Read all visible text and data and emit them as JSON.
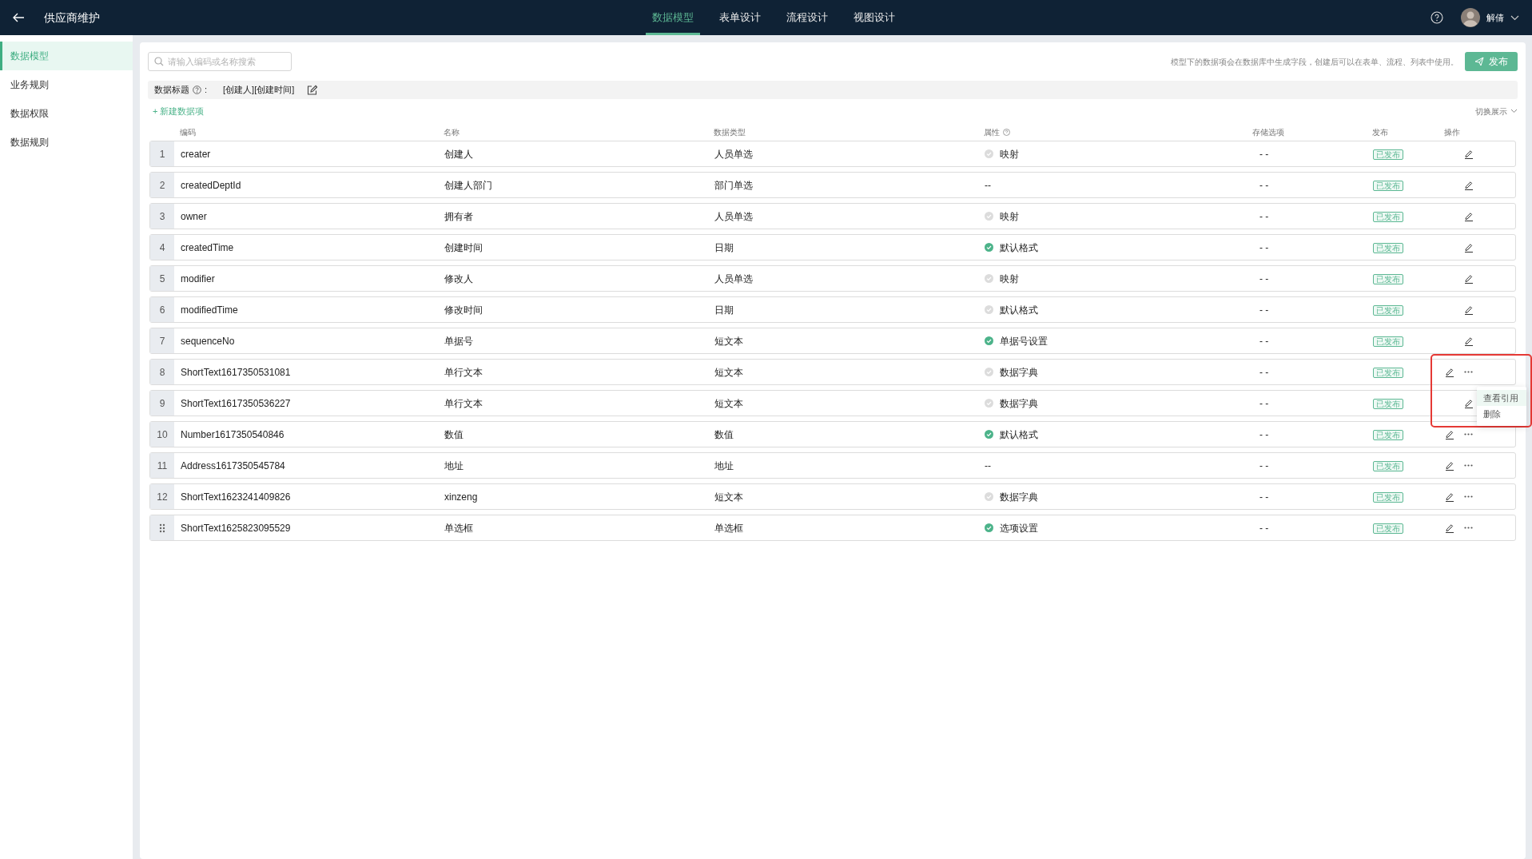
{
  "header": {
    "title": "供应商维护",
    "tabs": [
      {
        "label": "数据模型",
        "selected": true
      },
      {
        "label": "表单设计",
        "selected": false
      },
      {
        "label": "流程设计",
        "selected": false
      },
      {
        "label": "视图设计",
        "selected": false
      }
    ],
    "user": {
      "name": "解倩"
    }
  },
  "sidebar": {
    "items": [
      {
        "label": "数据模型",
        "selected": true
      },
      {
        "label": "业务规则",
        "selected": false
      },
      {
        "label": "数据权限",
        "selected": false
      },
      {
        "label": "数据规则",
        "selected": false
      }
    ]
  },
  "toolbar": {
    "search_placeholder": "请输入编码或名称搜索",
    "hint": "模型下的数据项会在数据库中生成字段，创建后可以在表单、流程、列表中使用。",
    "publish_button": "发布"
  },
  "data_title": {
    "label": "数据标题",
    "suffix": ":",
    "value": "[创建人][创建时间]"
  },
  "new_item": "+ 新建数据项",
  "toggle_view": "切换展示",
  "table": {
    "columns": [
      "编码",
      "名称",
      "数据类型",
      "属性",
      "存储选项",
      "发布",
      "操作"
    ],
    "rows": [
      {
        "kind": "numbered",
        "index": "1",
        "code": "creater",
        "name": "创建人",
        "type": "人员单选",
        "attribute": {
          "kind": "dot",
          "on": false,
          "text": "映射"
        },
        "storage": "- -",
        "status": "已发布",
        "more": false
      },
      {
        "kind": "numbered",
        "index": "2",
        "code": "createdDeptId",
        "name": "创建人部门",
        "type": "部门单选",
        "attribute": {
          "kind": "plain",
          "text": "--"
        },
        "storage": "- -",
        "status": "已发布",
        "more": false
      },
      {
        "kind": "numbered",
        "index": "3",
        "code": "owner",
        "name": "拥有者",
        "type": "人员单选",
        "attribute": {
          "kind": "dot",
          "on": false,
          "text": "映射"
        },
        "storage": "- -",
        "status": "已发布",
        "more": false
      },
      {
        "kind": "numbered",
        "index": "4",
        "code": "createdTime",
        "name": "创建时间",
        "type": "日期",
        "attribute": {
          "kind": "dot",
          "on": true,
          "text": "默认格式"
        },
        "storage": "- -",
        "status": "已发布",
        "more": false
      },
      {
        "kind": "numbered",
        "index": "5",
        "code": "modifier",
        "name": "修改人",
        "type": "人员单选",
        "attribute": {
          "kind": "dot",
          "on": false,
          "text": "映射"
        },
        "storage": "- -",
        "status": "已发布",
        "more": false
      },
      {
        "kind": "numbered",
        "index": "6",
        "code": "modifiedTime",
        "name": "修改时间",
        "type": "日期",
        "attribute": {
          "kind": "dot",
          "on": false,
          "text": "默认格式"
        },
        "storage": "- -",
        "status": "已发布",
        "more": false
      },
      {
        "kind": "numbered",
        "index": "7",
        "code": "sequenceNo",
        "name": "单据号",
        "type": "短文本",
        "attribute": {
          "kind": "dot",
          "on": true,
          "text": "单据号设置"
        },
        "storage": "- -",
        "status": "已发布",
        "more": false
      },
      {
        "kind": "numbered",
        "index": "8",
        "code": "ShortText1617350531081",
        "name": "单行文本",
        "type": "短文本",
        "attribute": {
          "kind": "dot",
          "on": false,
          "text": "数据字典"
        },
        "storage": "- -",
        "status": "已发布",
        "more": true,
        "menu": [
          {
            "label": "查看引用",
            "selected": true
          },
          {
            "label": "删除",
            "selected": false
          }
        ]
      },
      {
        "kind": "numbered",
        "index": "9",
        "code": "ShortText1617350536227",
        "name": "单行文本",
        "type": "短文本",
        "attribute": {
          "kind": "dot",
          "on": false,
          "text": "数据字典"
        },
        "storage": "- -",
        "status": "已发布",
        "more": false
      },
      {
        "kind": "numbered",
        "index": "10",
        "code": "Number1617350540846",
        "name": "数值",
        "type": "数值",
        "attribute": {
          "kind": "dot",
          "on": true,
          "text": "默认格式"
        },
        "storage": "- -",
        "status": "已发布",
        "more": true
      },
      {
        "kind": "numbered",
        "index": "11",
        "code": "Address1617350545784",
        "name": "地址",
        "type": "地址",
        "attribute": {
          "kind": "plain",
          "text": "--"
        },
        "storage": "- -",
        "status": "已发布",
        "more": true
      },
      {
        "kind": "numbered",
        "index": "12",
        "code": "ShortText1623241409826",
        "name": "xinzeng",
        "type": "短文本",
        "attribute": {
          "kind": "dot",
          "on": false,
          "text": "数据字典"
        },
        "storage": "- -",
        "status": "已发布",
        "more": true
      },
      {
        "kind": "drag",
        "code": "ShortText1625823095529",
        "name": "单选框",
        "type": "单选框",
        "attribute": {
          "kind": "dot",
          "on": true,
          "text": "选项设置"
        },
        "storage": "- -",
        "status": "已发布",
        "more": true
      }
    ]
  }
}
